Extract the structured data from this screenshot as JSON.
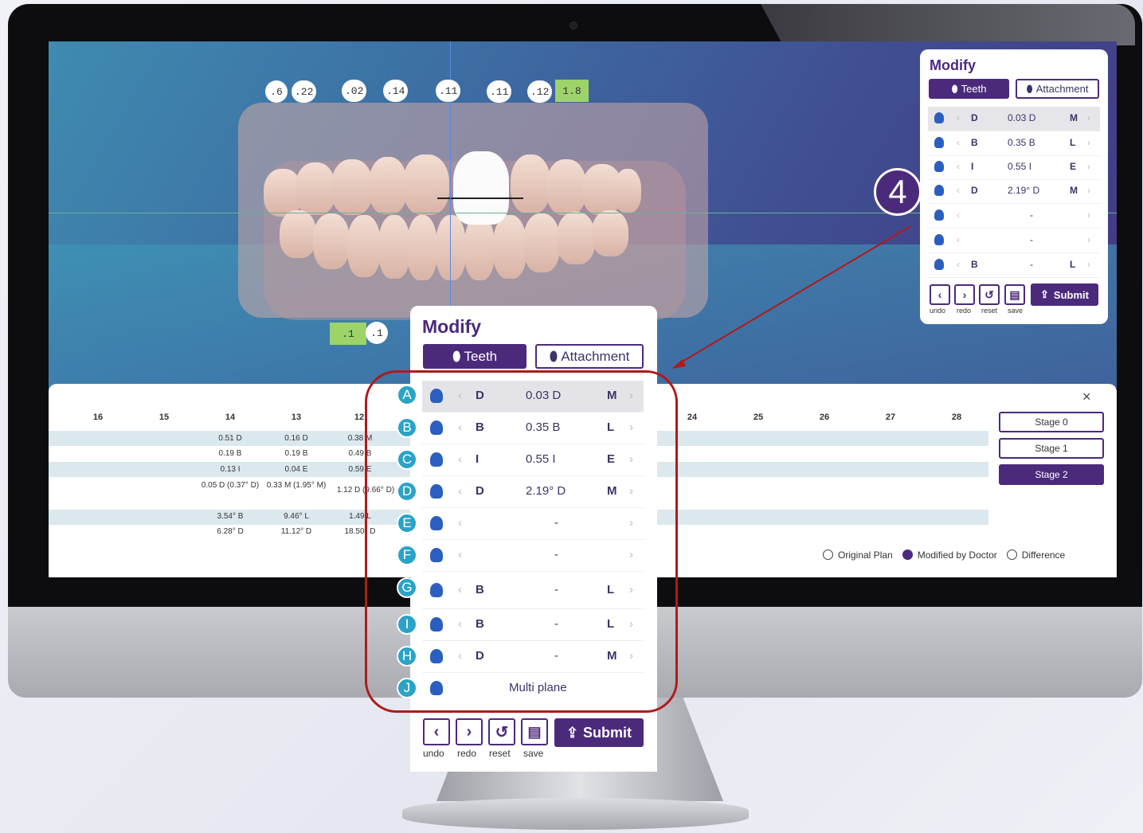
{
  "upper_tags": [
    ".6",
    ".22",
    ".02",
    ".14",
    ".11",
    ".11",
    ".12",
    "1.8"
  ],
  "lower_tags": [
    ".1",
    ".1"
  ],
  "table": {
    "headers": [
      "16",
      "15",
      "14",
      "13",
      "12",
      "24",
      "25",
      "26",
      "27",
      "28"
    ],
    "col14": [
      "0.51 D",
      "0.19 B",
      "0.13 I",
      "0.05 D (0.37° D)",
      "3.54° B",
      "6.28° D"
    ],
    "col13": [
      "0.16 D",
      "0.19 B",
      "0.04 E",
      "0.33 M (1.95° M)",
      "9.46° L",
      "11.12° D"
    ],
    "col12": [
      "0.38 M",
      "0.49 B",
      "0.59 E",
      "1.12 D (9.66° D)",
      "1.49 L",
      "18.50° D"
    ]
  },
  "stages": [
    "Stage 0",
    "Stage 1",
    "Stage 2"
  ],
  "legend": [
    "Original Plan",
    "Modified by Doctor",
    "Difference"
  ],
  "close_label": "×",
  "callout_number": "4",
  "modify": {
    "title": "Modify",
    "tab_teeth": "Teeth",
    "tab_attachment": "Attachment",
    "rows": [
      {
        "left": "D",
        "value": "0.03 D",
        "right": "M"
      },
      {
        "left": "B",
        "value": "0.35 B",
        "right": "L"
      },
      {
        "left": "I",
        "value": "0.55 I",
        "right": "E"
      },
      {
        "left": "D",
        "value": "2.19° D",
        "right": "M"
      },
      {
        "left": "",
        "value": "-",
        "right": ""
      },
      {
        "left": "",
        "value": "-",
        "right": ""
      },
      {
        "left": "B",
        "value": "-",
        "right": "L"
      },
      {
        "left": "B",
        "value": "-",
        "right": "L"
      },
      {
        "left": "D",
        "value": "-",
        "right": "M"
      },
      {
        "left": "",
        "value": "Multi plane",
        "right": ""
      }
    ],
    "badges": [
      "A",
      "B",
      "C",
      "D",
      "E",
      "F",
      "G",
      "I",
      "H",
      "J"
    ],
    "undo": "undo",
    "redo": "redo",
    "reset": "reset",
    "save": "save",
    "submit": "Submit"
  },
  "colors": {
    "brand": "#4b2a7c",
    "badge": "#2aa3c6",
    "highlight": "#b01a1a"
  }
}
